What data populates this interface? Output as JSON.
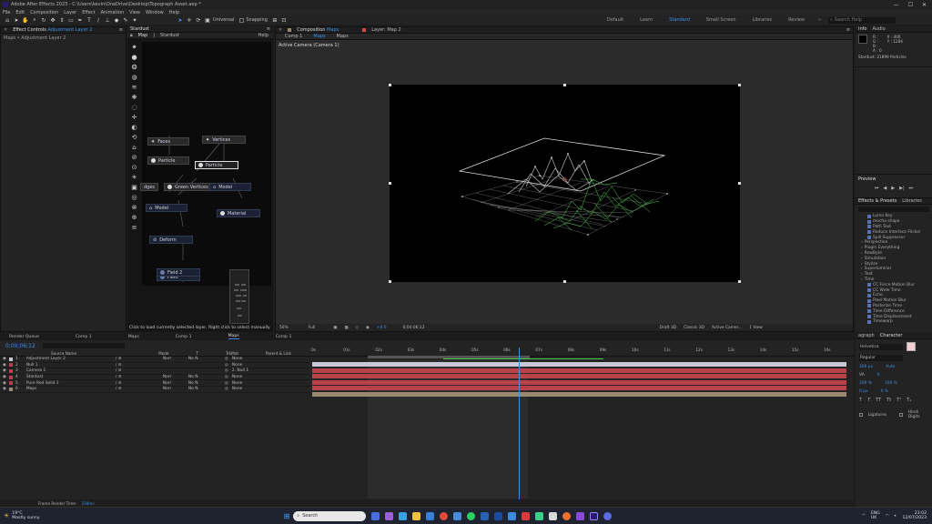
{
  "window": {
    "title": "Adobe After Effects 2023 - C:\\Users\\kevin\\OneDrive\\Desktop\\Topograph Asset.aep *",
    "controls": [
      "—",
      "☐",
      "✕"
    ]
  },
  "menu": [
    "File",
    "Edit",
    "Composition",
    "Layer",
    "Effect",
    "Animation",
    "View",
    "Window",
    "Help"
  ],
  "toolbar": {
    "universal_label": "Universal",
    "snapping_label": "Snapping",
    "workspaces": [
      "Default",
      "Learn",
      "Standard",
      "Small Screen",
      "Libraries",
      "Review"
    ],
    "active_workspace": "Standard",
    "search_placeholder": "Search Help"
  },
  "effect_controls": {
    "tab_label": "Effect Controls",
    "tab_target": "Adjustment Layer 2",
    "breadcrumb": "Maps • Adjustment Layer 2"
  },
  "stardust": {
    "panel_title": "Stardust",
    "tab_map": "Map",
    "tab_stardust": "Stardust",
    "help": "Help",
    "nodes": {
      "faces": "Faces",
      "vertices": "Vertices",
      "particle1": "Particle",
      "particle2": "Particle",
      "green_vertices": "Green Vertices",
      "model1": "Model",
      "edges": "dges",
      "model2": "Model",
      "material": "Material",
      "deform": "Deform",
      "field1": "Field",
      "field2": "Field 2"
    },
    "hint": "Click to load currently selected layer, Right click to select manually"
  },
  "composition": {
    "tab_label": "Composition",
    "tab_target": "Maps",
    "layer_tab": "Layer: Map 2",
    "subtabs": [
      "Comp 1",
      "Maps",
      "Maps"
    ],
    "active_subtab": "Maps",
    "camera_label": "Active Camera (Camera 1)",
    "footer": {
      "zoom": "50%",
      "quality": "Full",
      "exposure": "+0.0",
      "timecode": "0;00;06;12",
      "draft": "Draft 3D",
      "renderer": "Classic 3D",
      "view": "Active Camer...",
      "views": "1 View"
    }
  },
  "info_panel": {
    "tab_info": "Info",
    "tab_audio": "Audio",
    "rgb": [
      "R :",
      "G :",
      "B :",
      "A : 0"
    ],
    "coords": [
      "X : 406",
      "Y : 1284"
    ],
    "status": "Stardust: 21899 Particles"
  },
  "preview_panel": {
    "title": "Preview"
  },
  "effects_presets": {
    "title": "Effects & Presets",
    "libraries": "Libraries",
    "items": [
      {
        "label": "Luma Key",
        "sub": true
      },
      {
        "label": "mocha shape",
        "sub": true
      },
      {
        "label": "Path Text",
        "sub": true
      },
      {
        "label": "Reduce Interlace Flicker",
        "sub": true
      },
      {
        "label": "Spill Suppressor",
        "sub": true
      },
      {
        "label": "Perspective",
        "sub": false
      },
      {
        "label": "Plugin Everything",
        "sub": false
      },
      {
        "label": "RowByte",
        "sub": false
      },
      {
        "label": "Simulation",
        "sub": false
      },
      {
        "label": "Stylize",
        "sub": false
      },
      {
        "label": "Superluminal",
        "sub": false
      },
      {
        "label": "Text",
        "sub": false
      },
      {
        "label": "Time",
        "sub": false
      },
      {
        "label": "CC Force Motion Blur",
        "sub": true
      },
      {
        "label": "CC Wide Time",
        "sub": true
      },
      {
        "label": "Echo",
        "sub": true
      },
      {
        "label": "Pixel Motion Blur",
        "sub": true
      },
      {
        "label": "Posterize Time",
        "sub": true
      },
      {
        "label": "Time Difference",
        "sub": true
      },
      {
        "label": "Time Displacement",
        "sub": true
      },
      {
        "label": "Timewarp",
        "sub": true
      }
    ]
  },
  "timeline": {
    "tabs": [
      "Render Queue",
      "Comp 1",
      "Maps",
      "Comp 1",
      "Maps",
      "Comp 1"
    ],
    "active_tab_index": 4,
    "timecode": "0;00;06;12",
    "columns": [
      "Source Name",
      "Mode",
      "T",
      "TrkMat",
      "Parent & Link"
    ],
    "ruler": [
      "0s",
      "01s",
      "02s",
      "03s",
      "04s",
      "05s",
      "06s",
      "07s",
      "08s",
      "09s",
      "10s",
      "11s",
      "12s",
      "13s",
      "14s",
      "15s",
      "16s"
    ],
    "layers": [
      {
        "num": "1",
        "name": "Adjustment Layer 2",
        "mode": "Norr",
        "trk": "No N",
        "parent": "None",
        "color": "#c7c7d6"
      },
      {
        "num": "2",
        "name": "Null 1",
        "mode": "",
        "trk": "",
        "parent": "None",
        "color": "#b9424a"
      },
      {
        "num": "3",
        "name": "Camera 1",
        "mode": "",
        "trk": "",
        "parent": "2. Null 1",
        "color": "#b9424a"
      },
      {
        "num": "4",
        "name": "Stardust",
        "mode": "Norr",
        "trk": "No N",
        "parent": "None",
        "color": "#b9424a"
      },
      {
        "num": "5",
        "name": "Pure Red Solid 1",
        "mode": "Norr",
        "trk": "No N",
        "parent": "None",
        "color": "#b9424a"
      },
      {
        "num": "6",
        "name": "Maps",
        "mode": "Norr",
        "trk": "No N",
        "parent": "None",
        "color": "#9a8870"
      }
    ],
    "render_time_label": "Frame Render Time:",
    "render_time_value": "338ms"
  },
  "character_panel": {
    "tab_paragraph": "agraph",
    "tab_character": "Character",
    "font": "Helvetica",
    "style": "Regular",
    "size": "300 px",
    "leading": "Auto",
    "tracking": "0",
    "vscale": "100 %",
    "hscale": "100 %",
    "baseline": "0 px",
    "tsume": "0 %",
    "ligatures": "Ligatures",
    "hindi": "Hindi Digits"
  },
  "taskbar": {
    "weather_temp": "19°C",
    "weather_desc": "Mostly sunny",
    "search": "Search",
    "lang": "ENG",
    "region": "UK",
    "time": "23:02",
    "date": "12/07/2023"
  },
  "colors": {
    "accent": "#3d8fe6",
    "layer_red": "#b9424a",
    "mesh_green": "#4ccf4c"
  }
}
